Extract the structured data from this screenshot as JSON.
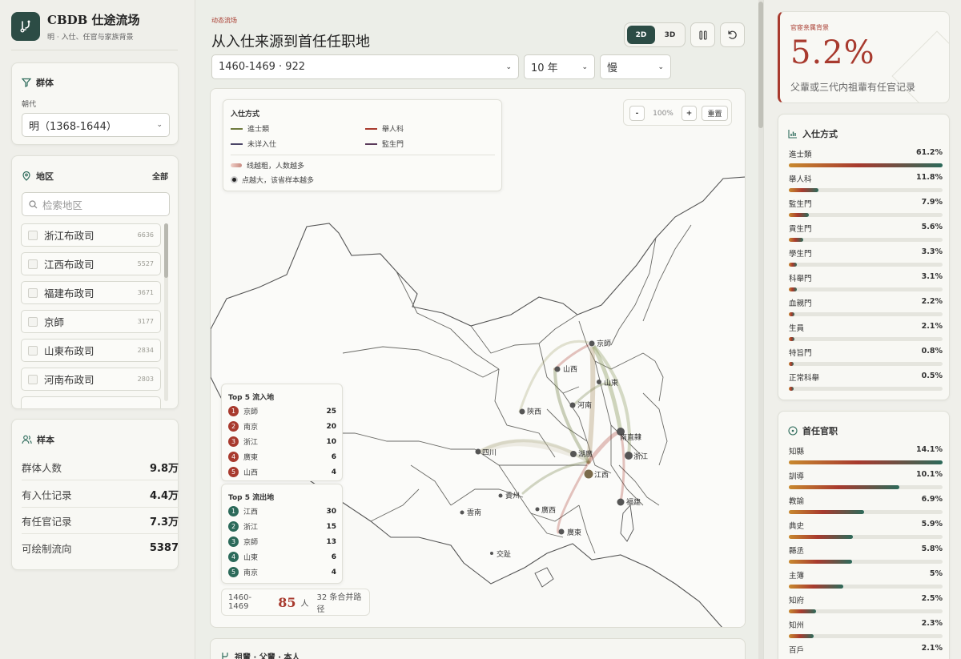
{
  "brand": {
    "name": "CBDB 仕途流场",
    "subtitle": "明 · 入仕、任官与家族背景"
  },
  "cohort": {
    "title": "群体",
    "dynasty_label": "朝代",
    "dynasty_value": "明（1368-1644）"
  },
  "region": {
    "title": "地区",
    "all_label": "全部",
    "search_placeholder": "检索地区",
    "items": [
      {
        "label": "浙江布政司",
        "count": "6636"
      },
      {
        "label": "江西布政司",
        "count": "5527"
      },
      {
        "label": "福建布政司",
        "count": "3671"
      },
      {
        "label": "京師",
        "count": "3177"
      },
      {
        "label": "山東布政司",
        "count": "2834"
      },
      {
        "label": "河南布政司",
        "count": "2803"
      }
    ]
  },
  "sample": {
    "title": "样本",
    "rows": [
      {
        "label": "群体人数",
        "value": "9.8万"
      },
      {
        "label": "有入仕记录",
        "value": "4.4万"
      },
      {
        "label": "有任官记录",
        "value": "7.3万"
      },
      {
        "label": "可绘制流向",
        "value": "5387"
      }
    ]
  },
  "header": {
    "kicker": "动态流场",
    "title": "从入仕来源到首任任职地",
    "mode_2d": "2D",
    "mode_3d": "3D",
    "period_select": "1460-1469 · 922",
    "step_select": "10 年",
    "speed_select": "慢"
  },
  "legend": {
    "title": "入仕方式",
    "items": [
      {
        "label": "進士類",
        "color": "#6e7a3e"
      },
      {
        "label": "舉人科",
        "color": "#a83a2e"
      },
      {
        "label": "未详入仕",
        "color": "#4a4566"
      },
      {
        "label": "監生門",
        "color": "#5a3a5a"
      }
    ],
    "note_line": "线越粗，人数越多",
    "note_dot": "点越大，该省样本越多"
  },
  "zoom": {
    "minus": "-",
    "level": "100%",
    "plus": "+",
    "reset": "重置"
  },
  "top_inflow": {
    "title": "Top 5 流入地",
    "rows": [
      {
        "rank": "1",
        "name": "京師",
        "value": "25"
      },
      {
        "rank": "2",
        "name": "南京",
        "value": "20"
      },
      {
        "rank": "3",
        "name": "浙江",
        "value": "10"
      },
      {
        "rank": "4",
        "name": "廣東",
        "value": "6"
      },
      {
        "rank": "5",
        "name": "山西",
        "value": "4"
      }
    ]
  },
  "top_outflow": {
    "title": "Top 5 流出地",
    "rows": [
      {
        "rank": "1",
        "name": "江西",
        "value": "30"
      },
      {
        "rank": "2",
        "name": "浙江",
        "value": "15"
      },
      {
        "rank": "3",
        "name": "京師",
        "value": "13"
      },
      {
        "rank": "4",
        "name": "山東",
        "value": "6"
      },
      {
        "rank": "5",
        "name": "南京",
        "value": "4"
      }
    ]
  },
  "summary": {
    "period": "1460-1469",
    "count": "85",
    "unit": "人",
    "paths": "32 条合并路径"
  },
  "map_labels": [
    "京師",
    "山西",
    "山東",
    "陝西",
    "河南",
    "南直隸",
    "浙江",
    "四川",
    "湖廣",
    "江西",
    "貴州",
    "福建",
    "雲南",
    "廣西",
    "廣東",
    "交趾"
  ],
  "next_section": {
    "title": "祖輩 · 父輩 · 本人"
  },
  "kpi": {
    "label": "官宦亲属背景",
    "value": "5.2%",
    "desc": "父輩或三代内祖輩有任官记录"
  },
  "entry_methods": {
    "title": "入仕方式",
    "rows": [
      {
        "label": "進士類",
        "pct_text": "61.2%",
        "pct": 61.2
      },
      {
        "label": "舉人科",
        "pct_text": "11.8%",
        "pct": 11.8
      },
      {
        "label": "監生門",
        "pct_text": "7.9%",
        "pct": 7.9
      },
      {
        "label": "貢生門",
        "pct_text": "5.6%",
        "pct": 5.6
      },
      {
        "label": "學生門",
        "pct_text": "3.3%",
        "pct": 3.3
      },
      {
        "label": "科舉門",
        "pct_text": "3.1%",
        "pct": 3.1
      },
      {
        "label": "血親門",
        "pct_text": "2.2%",
        "pct": 2.2
      },
      {
        "label": "生員",
        "pct_text": "2.1%",
        "pct": 2.1
      },
      {
        "label": "特旨門",
        "pct_text": "0.8%",
        "pct": 0.8
      },
      {
        "label": "正常科舉",
        "pct_text": "0.5%",
        "pct": 0.5
      }
    ]
  },
  "first_posts": {
    "title": "首任官职",
    "rows": [
      {
        "label": "知縣",
        "pct_text": "14.1%",
        "pct": 14.1
      },
      {
        "label": "訓導",
        "pct_text": "10.1%",
        "pct": 10.1
      },
      {
        "label": "教諭",
        "pct_text": "6.9%",
        "pct": 6.9
      },
      {
        "label": "典史",
        "pct_text": "5.9%",
        "pct": 5.9
      },
      {
        "label": "縣丞",
        "pct_text": "5.8%",
        "pct": 5.8
      },
      {
        "label": "主簿",
        "pct_text": "5%",
        "pct": 5
      },
      {
        "label": "知府",
        "pct_text": "2.5%",
        "pct": 2.5
      },
      {
        "label": "知州",
        "pct_text": "2.3%",
        "pct": 2.3
      },
      {
        "label": "百戶",
        "pct_text": "2.1%",
        "pct": 2.1
      }
    ]
  },
  "colors": {
    "accent": "#2c4c45",
    "red": "#a83a2e",
    "green": "#2c6a5a",
    "olive": "#6e7a3e"
  }
}
